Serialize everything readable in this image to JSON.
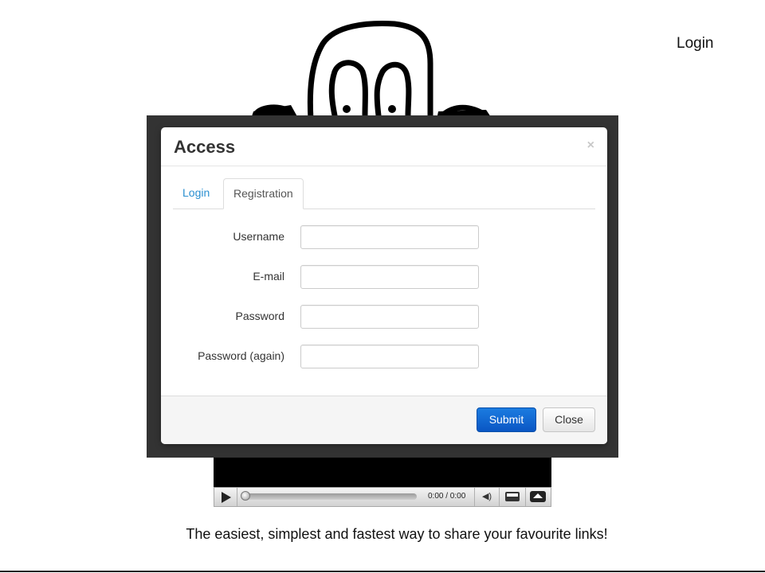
{
  "header": {
    "login_link": "Login"
  },
  "modal": {
    "title": "Access",
    "close_symbol": "×",
    "tabs": [
      {
        "label": "Login",
        "active": false
      },
      {
        "label": "Registration",
        "active": true
      }
    ],
    "fields": [
      {
        "label": "Username",
        "value": "",
        "placeholder": ""
      },
      {
        "label": "E-mail",
        "value": "",
        "placeholder": ""
      },
      {
        "label": "Password",
        "value": "",
        "placeholder": ""
      },
      {
        "label": "Password (again)",
        "value": "",
        "placeholder": ""
      }
    ],
    "buttons": {
      "submit": "Submit",
      "close": "Close"
    }
  },
  "player": {
    "time": "0:00 / 0:00",
    "progress": 0,
    "icons": [
      "play-icon",
      "seek-knob-icon",
      "volume-icon",
      "fullscreen-icon",
      "eject-icon"
    ]
  },
  "footer": {
    "tagline": "The easiest, simplest and fastest way to share your favourite links!"
  },
  "colors": {
    "accent_blue": "#0a56c4",
    "tab_link_blue": "#2a8fd0",
    "backdrop": "#333333",
    "footer_bg": "#f5f5f5"
  }
}
